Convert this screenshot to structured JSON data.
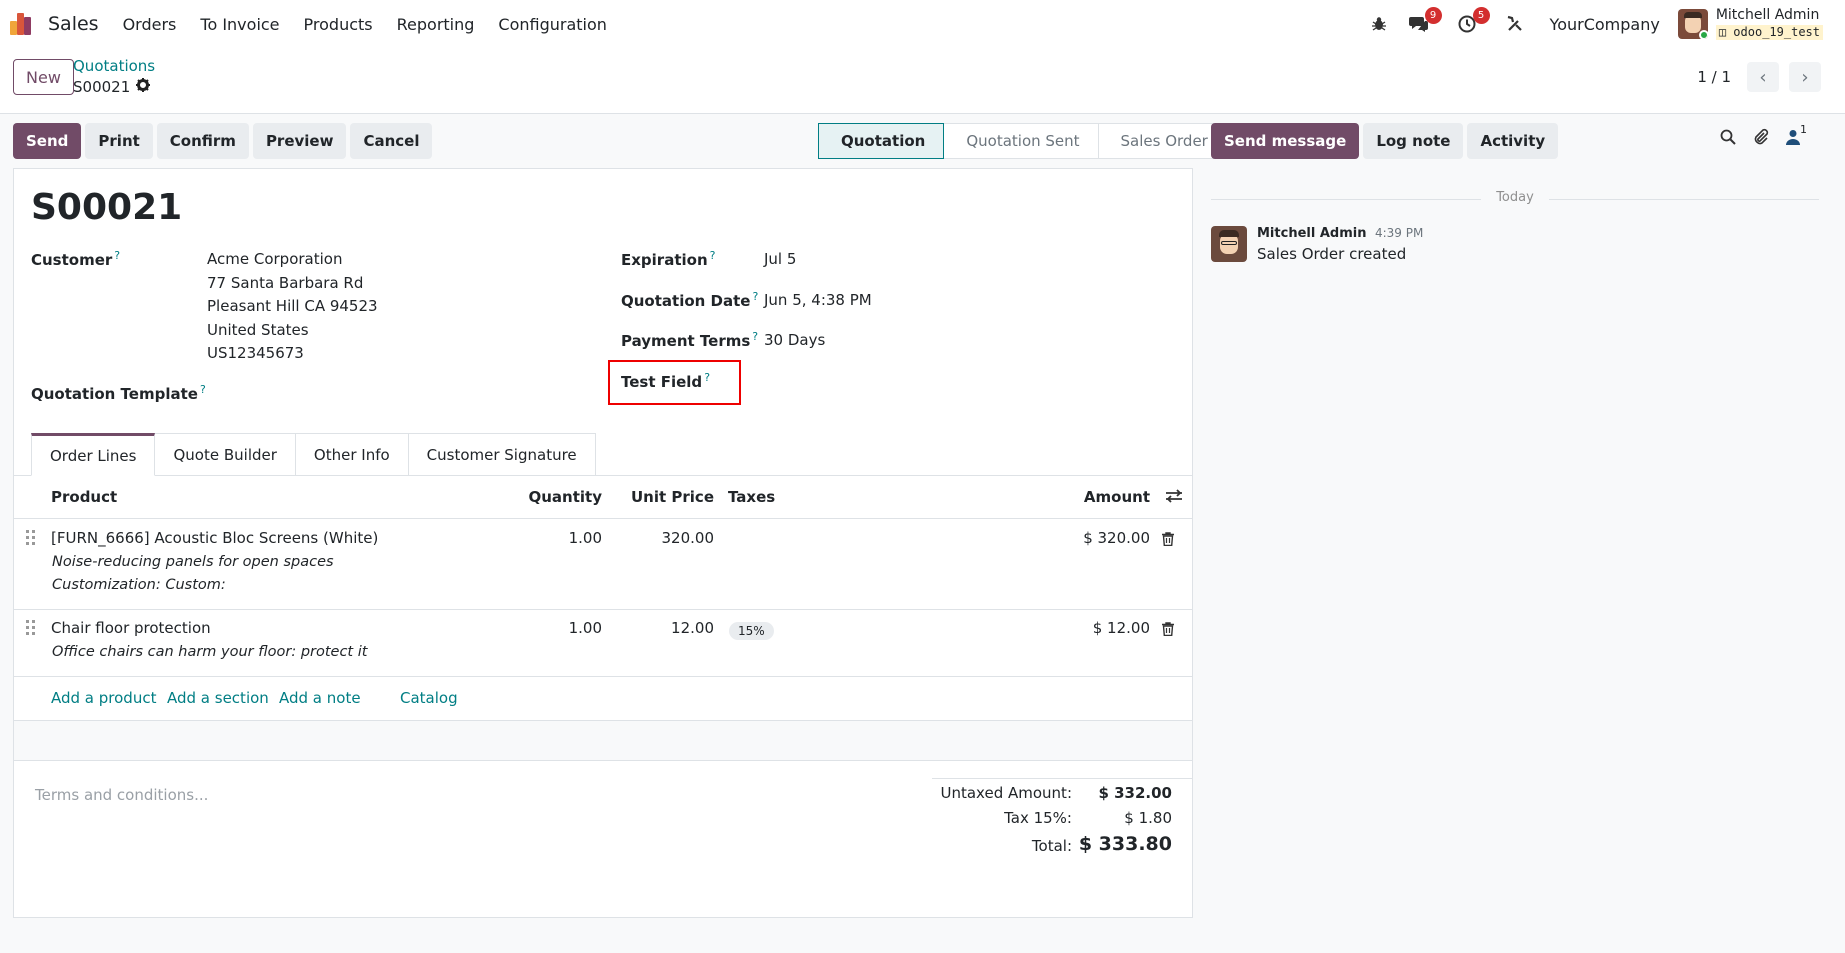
{
  "nav": {
    "app_name": "Sales",
    "menu": [
      "Orders",
      "To Invoice",
      "Products",
      "Reporting",
      "Configuration"
    ],
    "messages_count": "9",
    "activities_count": "5",
    "company": "YourCompany",
    "user_name": "Mitchell Admin",
    "database": "odoo_19_test"
  },
  "control": {
    "new_label": "New",
    "breadcrumb_parent": "Quotations",
    "breadcrumb_current": "S00021",
    "pager": "1 / 1"
  },
  "actions": {
    "send": "Send",
    "print": "Print",
    "confirm": "Confirm",
    "preview": "Preview",
    "cancel": "Cancel"
  },
  "stages": [
    "Quotation",
    "Quotation Sent",
    "Sales Order"
  ],
  "chatter": {
    "send_message": "Send message",
    "log_note": "Log note",
    "activity": "Activity",
    "followers_count": "1",
    "day_separator": "Today",
    "message": {
      "author": "Mitchell Admin",
      "time": "4:39 PM",
      "body": "Sales Order created"
    }
  },
  "form": {
    "order_name": "S00021",
    "customer_label": "Customer",
    "customer_lines": [
      "Acme Corporation",
      "77 Santa Barbara Rd",
      "Pleasant Hill CA 94523",
      "United States",
      "US12345673"
    ],
    "template_label": "Quotation Template",
    "expiration_label": "Expiration",
    "expiration_value": "Jul 5",
    "quotation_date_label": "Quotation Date",
    "quotation_date_value": "Jun 5, 4:38 PM",
    "payment_terms_label": "Payment Terms",
    "payment_terms_value": "30 Days",
    "test_field_label": "Test Field",
    "help_mark": "?"
  },
  "tabs": [
    "Order Lines",
    "Quote Builder",
    "Other Info",
    "Customer Signature"
  ],
  "table": {
    "headers": {
      "product": "Product",
      "quantity": "Quantity",
      "unit_price": "Unit Price",
      "taxes": "Taxes",
      "amount": "Amount"
    },
    "rows": [
      {
        "product": "[FURN_6666] Acoustic Bloc Screens (White)",
        "desc1": "Noise-reducing panels for open spaces",
        "desc2": "Customization: Custom:",
        "quantity": "1.00",
        "unit_price": "320.00",
        "tax": "",
        "amount": "$ 320.00"
      },
      {
        "product": "Chair floor protection",
        "desc1": "Office chairs can harm your floor: protect it",
        "desc2": "",
        "quantity": "1.00",
        "unit_price": "12.00",
        "tax": "15%",
        "amount": "$ 12.00"
      }
    ],
    "add_product": "Add a product",
    "add_section": "Add a section",
    "add_note": "Add a note",
    "catalog": "Catalog"
  },
  "footer": {
    "terms_placeholder": "Terms and conditions...",
    "untaxed_label": "Untaxed Amount:",
    "untaxed_value": "$ 332.00",
    "tax_label": "Tax 15%:",
    "tax_value": "$ 1.80",
    "total_label": "Total:",
    "total_value": "$ 333.80"
  },
  "colors": {
    "brand": "#714b67",
    "link": "#017e84",
    "highlight": "#ee0000"
  }
}
